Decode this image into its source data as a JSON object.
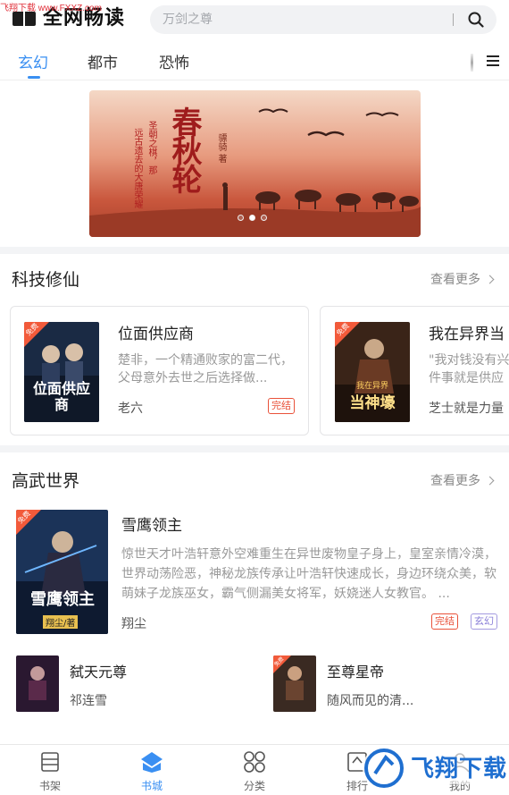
{
  "watermark_top": "飞翔下载 www.FXXZ.com",
  "header": {
    "app_name": "全网畅读",
    "search_placeholder": "万剑之尊"
  },
  "tabs": [
    {
      "label": "玄幻",
      "active": true
    },
    {
      "label": "都市",
      "active": false
    },
    {
      "label": "恐怖",
      "active": false
    }
  ],
  "banner": {
    "title": "春秋轮",
    "tagline_1": "远古遗去的大唐荣耀",
    "tagline_2": "圣朝之棋，那",
    "author": "骠骑 著",
    "slide_count": 3,
    "active_slide": 2
  },
  "section1": {
    "title": "科技修仙",
    "more": "查看更多",
    "books": [
      {
        "title": "位面供应商",
        "desc": "楚非，一个精通败家的富二代，父母意外去世之后选择做...",
        "author": "老六",
        "tag": "完结",
        "badge": "免费",
        "cover_text": "位面供应商"
      },
      {
        "title": "我在异界当",
        "desc": "\"我对钱没有兴一件事就是供应",
        "author": "芝士就是力量",
        "badge": "免费",
        "cover_text": "当神壕",
        "cover_sub": "我在异界"
      }
    ]
  },
  "section2": {
    "title": "高武世界",
    "more": "查看更多",
    "featured": {
      "title": "雪鹰领主",
      "desc": "惊世天才叶浩轩意外空难重生在异世废物皇子身上，皇室亲情冷漠，世界动荡险恶，神秘龙族传承让叶浩轩快速成长，身边环绕众美，软萌妹子龙族巫女，霸气侧漏美女将军，妖娆迷人女教官。 ...",
      "author": "翔尘",
      "tags": [
        "完结",
        "玄幻"
      ],
      "badge": "免费",
      "cover_text": "雪鹰领主",
      "cover_author": "翔尘/著"
    },
    "list": [
      {
        "title": "弑天元尊",
        "author": "祁连雪"
      },
      {
        "title": "至尊星帝",
        "author": "随风而见的清...",
        "badge": "免费"
      }
    ]
  },
  "bottom_nav": [
    {
      "label": "书架",
      "icon": "bookshelf-icon",
      "active": false
    },
    {
      "label": "书城",
      "icon": "bookstore-icon",
      "active": true
    },
    {
      "label": "分类",
      "icon": "category-icon",
      "active": false
    },
    {
      "label": "排行",
      "icon": "ranking-icon",
      "active": false
    },
    {
      "label": "我的",
      "icon": "profile-icon",
      "active": false
    }
  ],
  "watermark_logo": "飞翔下载",
  "colors": {
    "accent": "#3a8ff2",
    "tag_red": "#e9523a",
    "tag_purple": "#8a7fd8"
  }
}
